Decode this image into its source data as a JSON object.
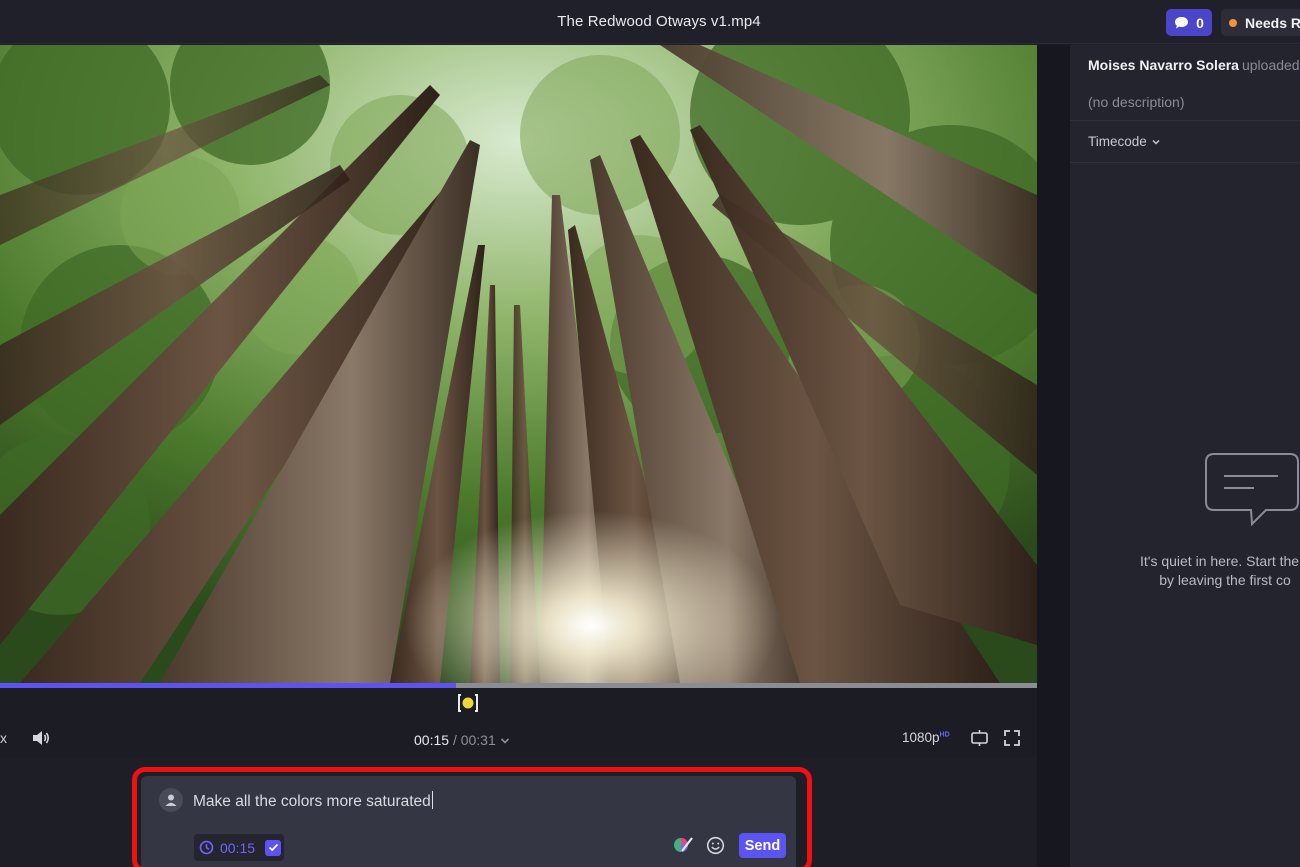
{
  "header": {
    "file_title": "The Redwood Otways v1.mp4",
    "comment_count": "0",
    "status": "Needs R",
    "status_color": "#f5923e"
  },
  "player": {
    "speed_suffix": "x",
    "current_time": "00:15",
    "total_time": "/ 00:31",
    "quality": "1080p",
    "quality_badge": "HD",
    "progress_fraction": 0.44
  },
  "composer": {
    "text": "Make all the colors more saturated",
    "time_chip": "00:15",
    "send_label": "Send"
  },
  "panel": {
    "uploader_name": "Moises Navarro Solera",
    "uploader_verb": "uploaded",
    "description": "(no description)",
    "sort_label": "Timecode",
    "empty_line1": "It's quiet in here. Start the c",
    "empty_line2": "by leaving the first co"
  },
  "colors": {
    "accent": "#5b53f2",
    "highlight": "#ee1111"
  }
}
